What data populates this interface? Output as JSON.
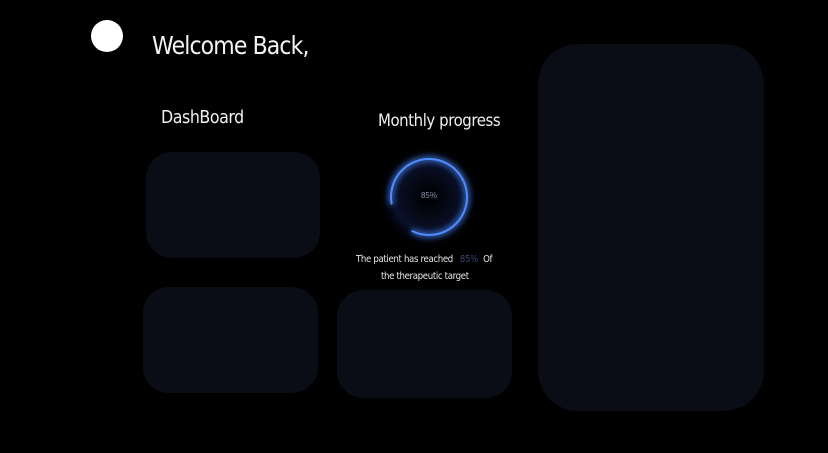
{
  "header": {
    "greeting": "Welcome Back,"
  },
  "dashboard": {
    "title": "DashBoard"
  },
  "monthly_progress": {
    "title": "Monthly progress",
    "ring_label": "85%",
    "progress_fraction": 0.85,
    "caption_prefix": "The patient has reached",
    "caption_value": "85%",
    "caption_suffix": "Of",
    "caption_line2": "the therapeutic target"
  },
  "colors": {
    "background": "#000000",
    "card": "#0a0c16",
    "accent": "#4f8cff",
    "avatar": "#ffffff"
  }
}
